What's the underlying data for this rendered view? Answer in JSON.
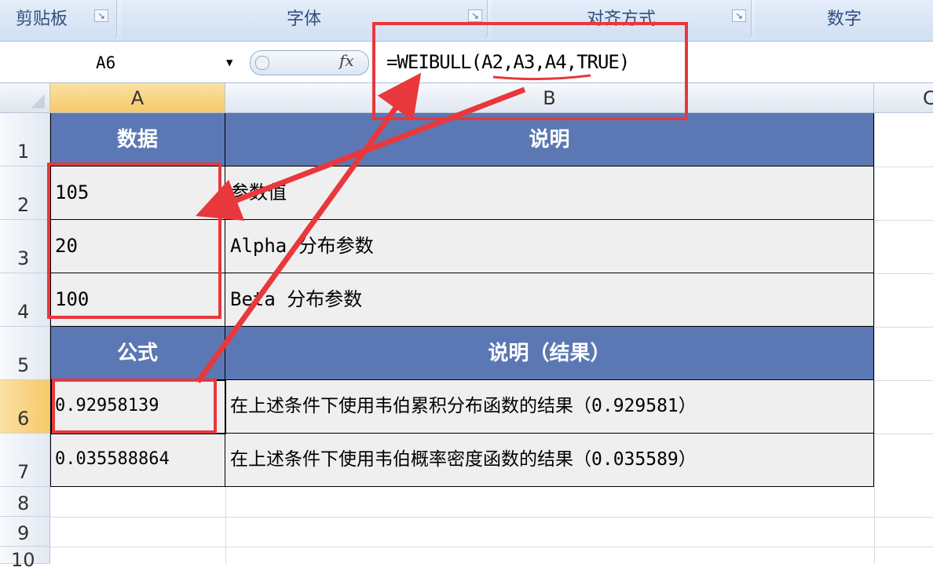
{
  "ribbon": {
    "groups": [
      "剪贴板",
      "字体",
      "对齐方式",
      "数字"
    ]
  },
  "formula_bar": {
    "name_box": "A6",
    "fx_label": "fx",
    "formula": "=WEIBULL(A2,A3,A4,TRUE)"
  },
  "columns": [
    "A",
    "B",
    "C"
  ],
  "rows": [
    "1",
    "2",
    "3",
    "4",
    "5",
    "6",
    "7",
    "8",
    "9",
    "10"
  ],
  "table": {
    "header1": {
      "a": "数据",
      "b": "说明"
    },
    "data_rows": [
      {
        "a": "105",
        "b": "参数值"
      },
      {
        "a": "20",
        "b": "Alpha 分布参数"
      },
      {
        "a": "100",
        "b": "Beta 分布参数"
      }
    ],
    "header2": {
      "a": "公式",
      "b": "说明（结果）"
    },
    "result_rows": [
      {
        "a": "0.92958139",
        "b": "在上述条件下使用韦伯累积分布函数的结果（0.929581）"
      },
      {
        "a": "0.035588864",
        "b": "在上述条件下使用韦伯概率密度函数的结果（0.035589）"
      }
    ]
  },
  "colors": {
    "header_fill": "#5b78b4",
    "body_fill": "#efefef",
    "annotation_red": "#e8383c",
    "selected_header": "#f6c96a"
  }
}
